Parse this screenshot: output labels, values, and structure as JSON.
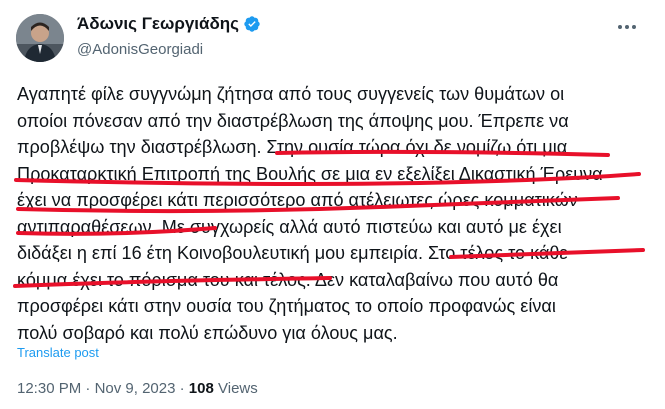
{
  "author": {
    "display_name": "Άδωνις Γεωργιάδης",
    "handle": "@AdonisGeorgiadi",
    "verified": true
  },
  "tweet": {
    "lines": [
      "Αγαπητέ φίλε συγγνώμη ζήτησα από τους συγγενείς των θυμάτων οι",
      "οποίοι πόνεσαν από την διαστρέβλωση της άποψης μου. Έπρεπε να",
      "προβλέψω την διαστρέβλωση. Στην ουσία τώρα όχι δε νομίζω ότι μια",
      "Προκαταρκτική Επιτροπή της Βουλής σε μια εν εξελίξει Δικαστική Έρευνα",
      "έχει να προσφέρει κάτι περισσότερο από ατέλειωτες ώρες κομματικών",
      "αντιπαραθέσεων. Με συγχωρείς αλλά αυτό πιστεύω και αυτό με έχει",
      "διδάξει η επί 16 έτη Κοινοβουλευτική μου εμπειρία. Στο τέλος το κάθε",
      "κόμμα έχει το πόρισμα του και τέλος. Δεν καταλαβαίνω που αυτό θα",
      "προσφέρει κάτι στην ουσία του ζητήματος το οποίο προφανώς είναι",
      "πολύ σοβαρό και πολύ επώδυνο για όλους μας."
    ],
    "translate_label": "Translate post",
    "time": "12:30 PM",
    "separator": "·",
    "date": "Nov 9, 2023",
    "views_count": "108",
    "views_label": "Views"
  },
  "colors": {
    "text": "#0f1419",
    "secondary": "#536471",
    "link": "#1d9bf0",
    "verified": "#1d9bf0",
    "underline_marks": "#e8102a"
  },
  "icons": {
    "verified": "verified-badge-icon",
    "more": "more-options-icon",
    "avatar": "profile-avatar"
  }
}
